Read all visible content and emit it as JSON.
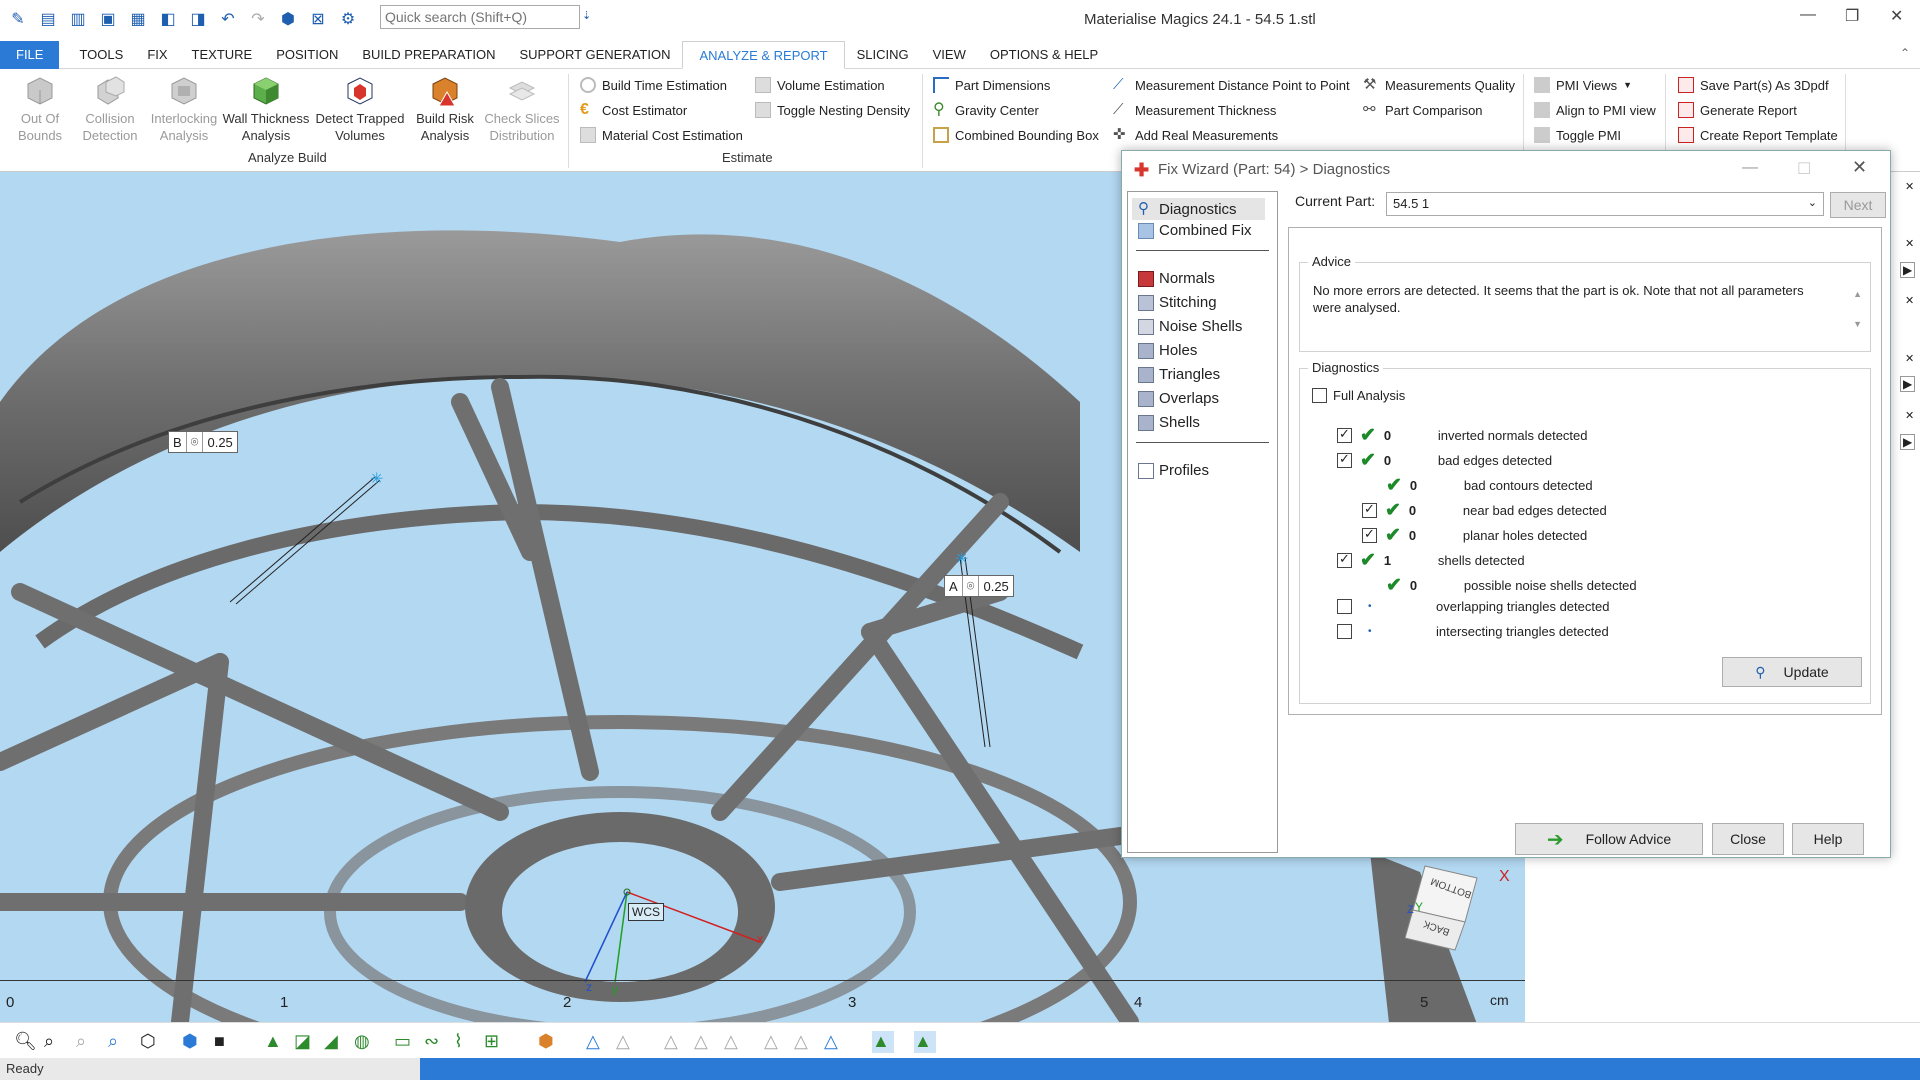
{
  "window": {
    "title": "Materialise Magics 24.1 - 54.5    1.stl"
  },
  "quick_search": {
    "placeholder": "Quick search (Shift+Q)"
  },
  "tabs": [
    "FILE",
    "TOOLS",
    "FIX",
    "TEXTURE",
    "POSITION",
    "BUILD PREPARATION",
    "SUPPORT GENERATION",
    "ANALYZE & REPORT",
    "SLICING",
    "VIEW",
    "OPTIONS & HELP"
  ],
  "active_tab": "ANALYZE & REPORT",
  "ribbon": {
    "analyze_build": {
      "group_label": "Analyze Build",
      "buttons": [
        "Out Of Bounds",
        "Collision Detection",
        "Interlocking Analysis",
        "Wall Thickness Analysis",
        "Detect Trapped Volumes",
        "Build Risk Analysis",
        "Check Slices Distribution"
      ]
    },
    "estimate": {
      "group_label": "Estimate",
      "items": [
        "Build Time Estimation",
        "Cost Estimator",
        "Material Cost Estimation",
        "Volume Estimation",
        "Toggle Nesting Density"
      ]
    },
    "measure": {
      "items": [
        "Part Dimensions",
        "Gravity Center",
        "Combined Bounding Box",
        "Measurement Distance Point to Point",
        "Measurement Thickness",
        "Add Real Measurements",
        "Measurements Quality",
        "Part Comparison"
      ]
    },
    "pmi": {
      "items": [
        "PMI Views",
        "Align to PMI view",
        "Toggle PMI"
      ]
    },
    "report": {
      "items": [
        "Save Part(s) As 3Dpdf",
        "Generate Report",
        "Create Report Template"
      ]
    }
  },
  "viewport": {
    "measurements": [
      {
        "label": "B",
        "symbol": "⌾",
        "value": "0.25"
      },
      {
        "label": "A",
        "symbol": "⌾",
        "value": "0.25"
      }
    ],
    "wcs_label": "WCS",
    "axis_labels": {
      "x": "x",
      "y": "y",
      "z": "z"
    },
    "ruler": {
      "ticks": [
        "0",
        "1",
        "2",
        "3",
        "4",
        "5"
      ],
      "unit": "cm"
    },
    "viewcube": {
      "faces": [
        "BOTTOM",
        "BACK"
      ],
      "labels": {
        "z": "Z",
        "y": "Y"
      },
      "close": "X"
    }
  },
  "dialog": {
    "title": "Fix Wizard (Part: 54) > Diagnostics",
    "nav_items": [
      "Diagnostics",
      "Combined Fix",
      "Normals",
      "Stitching",
      "Noise Shells",
      "Holes",
      "Triangles",
      "Overlaps",
      "Shells",
      "Profiles"
    ],
    "current_part_label": "Current Part:",
    "current_part_value": "54.5   1",
    "next_label": "Next",
    "advice_legend": "Advice",
    "advice_text": "No more errors are detected. It seems that the part is ok. Note that not all parameters were analysed.",
    "diagnostics_legend": "Diagnostics",
    "full_analysis_label": "Full Analysis",
    "rows": [
      {
        "count": "0",
        "text": "inverted normals detected"
      },
      {
        "count": "0",
        "text": "bad edges detected"
      },
      {
        "count": "0",
        "text": "bad contours detected"
      },
      {
        "count": "0",
        "text": "near bad edges detected"
      },
      {
        "count": "0",
        "text": "planar holes detected"
      },
      {
        "count": "1",
        "text": "shells detected"
      },
      {
        "count": "0",
        "text": "possible noise shells detected"
      },
      {
        "count": "",
        "text": "overlapping triangles detected"
      },
      {
        "count": "",
        "text": "intersecting triangles detected"
      }
    ],
    "update_label": "Update",
    "follow_advice_label": "Follow Advice",
    "close_label": "Close",
    "help_label": "Help"
  },
  "status": {
    "text": "Ready"
  },
  "colors": {
    "accent": "#2b7bd6",
    "viewport_bg": "#b3d8f2",
    "check_green": "#1d8a2a"
  }
}
